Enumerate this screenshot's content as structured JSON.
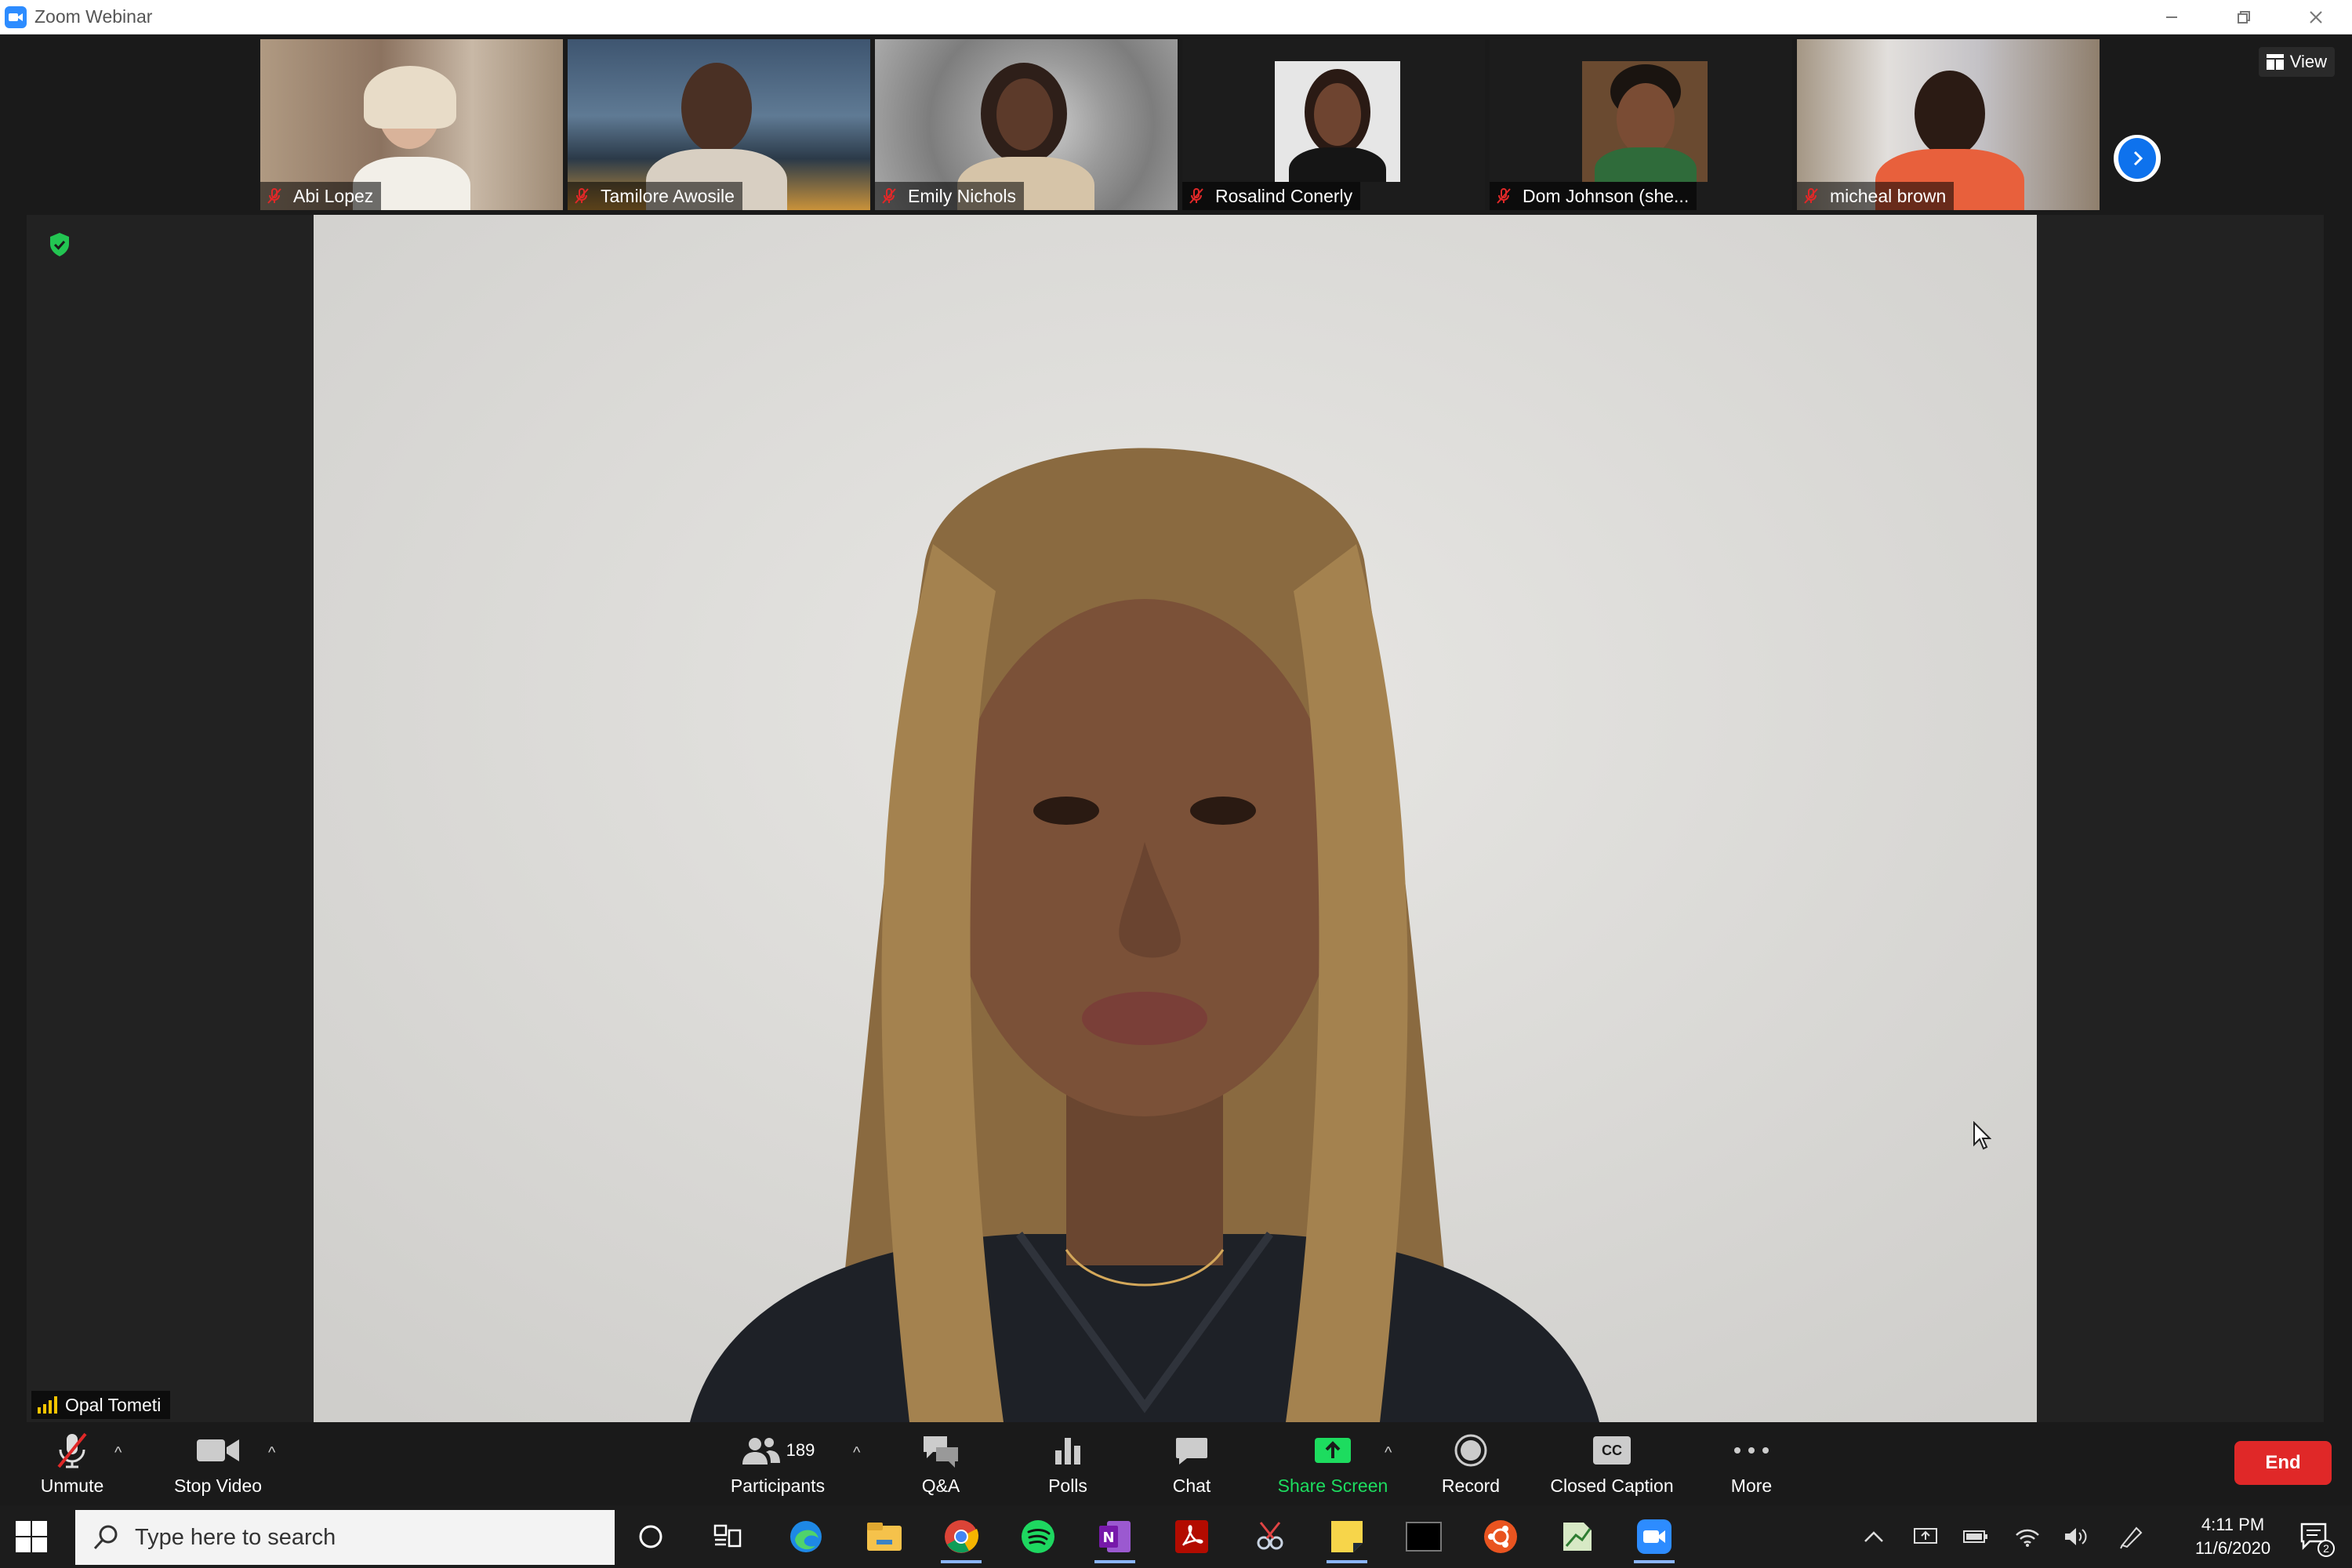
{
  "window": {
    "title": "Zoom Webinar"
  },
  "participants_strip": [
    {
      "name": "Abi Lopez"
    },
    {
      "name": "Tamilore Awosile"
    },
    {
      "name": "Emily Nichols"
    },
    {
      "name": "Rosalind Conerly"
    },
    {
      "name": "Dom Johnson (she..."
    },
    {
      "name": "micheal brown"
    }
  ],
  "view_button": {
    "label": "View"
  },
  "speaker": {
    "name": "Opal Tometi"
  },
  "toolbar": {
    "unmute": "Unmute",
    "stop_video": "Stop Video",
    "participants": "Participants",
    "participant_count": "189",
    "qa": "Q&A",
    "polls": "Polls",
    "chat": "Chat",
    "share_screen": "Share Screen",
    "record": "Record",
    "closed_caption": "Closed Caption",
    "cc_badge": "CC",
    "more": "More",
    "end": "End"
  },
  "taskbar": {
    "search_placeholder": "Type here to search",
    "time": "4:11 PM",
    "date": "11/6/2020",
    "notification_count": "2"
  },
  "colors": {
    "accent_blue": "#2d8cff",
    "share_green": "#1ddc5f",
    "end_red": "#e02828",
    "muted_red": "#e02828"
  }
}
